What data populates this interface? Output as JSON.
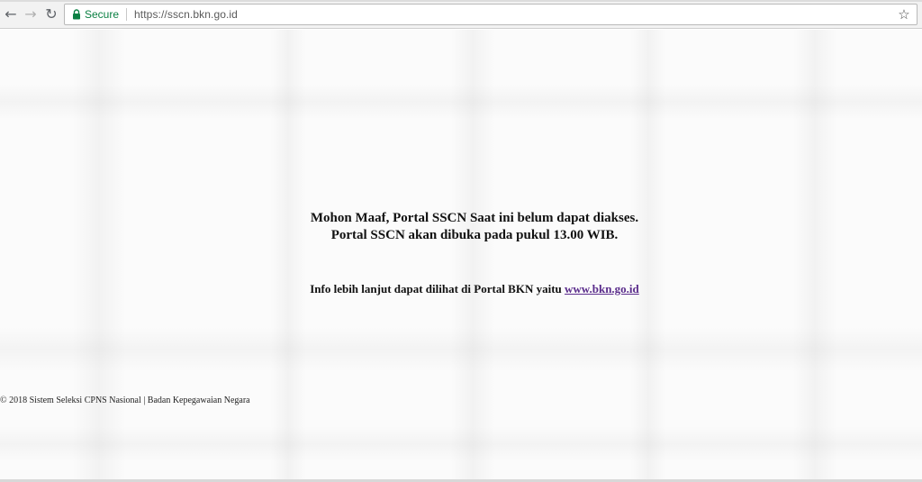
{
  "browser": {
    "secure_label": "Secure",
    "url": "https://sscn.bkn.go.id"
  },
  "page": {
    "message_line1": "Mohon Maaf, Portal SSCN Saat ini belum dapat diakses.",
    "message_line2": "Portal SSCN akan dibuka pada pukul 13.00 WIB.",
    "info_text": "Info lebih lanjut dapat dilihat di Portal BKN yaitu ",
    "info_link": "www.bkn.go.id",
    "footer": "© 2018 Sistem Seleksi CPNS Nasional | Badan Kepegawaian Negara"
  },
  "colors": {
    "secure_green": "#0b8043",
    "link_visited": "#5b2d8c"
  }
}
